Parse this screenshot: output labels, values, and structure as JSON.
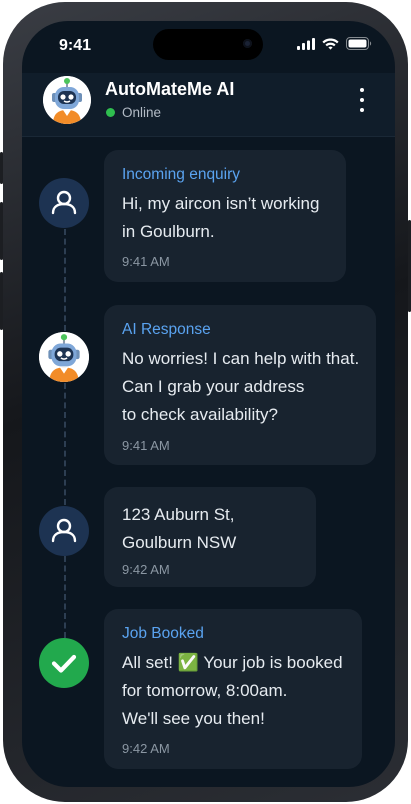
{
  "status_bar": {
    "time": "9:41"
  },
  "header": {
    "title": "AutoMateMe AI",
    "status": "Online",
    "avatar_icon": "robot-avatar-icon",
    "menu_icon": "more-vertical-icon"
  },
  "colors": {
    "accent": "#5aa3f0",
    "online": "#2fbe4f",
    "success": "#22a94d",
    "background": "#0b1621",
    "bubble": "#18232f"
  },
  "messages": [
    {
      "icon": "user-icon",
      "label": "Incoming enquiry",
      "lines": [
        "Hi, my aircon isn’t working",
        "in Goulburn."
      ],
      "time": "9:41 AM"
    },
    {
      "icon": "robot-avatar-icon",
      "label": "AI Response",
      "lines": [
        "No worries! I can help with that.",
        "Can I grab your address",
        "to check availability?"
      ],
      "time": "9:41 AM"
    },
    {
      "icon": "user-icon",
      "lines": [
        "123 Auburn St,",
        "Goulburn NSW"
      ],
      "time": "9:42 AM"
    },
    {
      "icon": "check-icon",
      "label": "Job Booked",
      "lines": [
        "All set! ✅ Your job is booked",
        "for tomorrow, 8:00am.",
        "We'll see you then!"
      ],
      "time": "9:42 AM"
    }
  ]
}
